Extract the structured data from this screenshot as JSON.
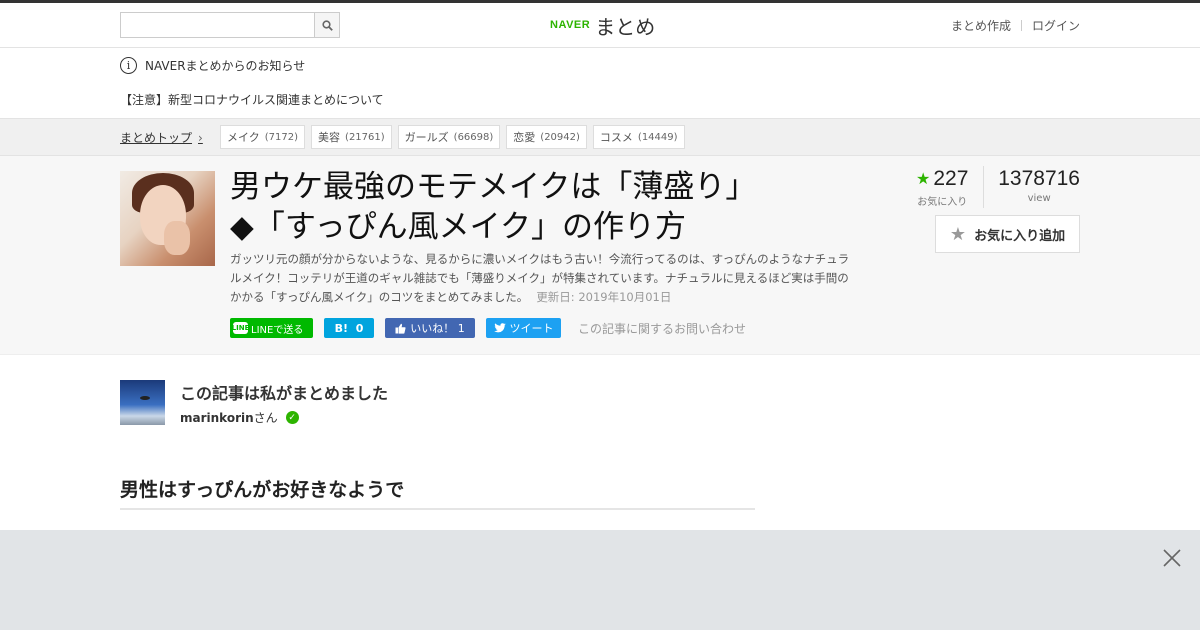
{
  "header": {
    "search_placeholder": "",
    "logo_brand": "NAVER",
    "logo_text": "まとめ",
    "create_label": "まとめ作成",
    "login_label": "ログイン"
  },
  "notice": {
    "title": "NAVERまとめからのお知らせ",
    "link": "【注意】新型コロナウイルス関連まとめについて"
  },
  "categories": {
    "top_label": "まとめトップ",
    "items": [
      {
        "name": "メイク",
        "count": "(7172)"
      },
      {
        "name": "美容",
        "count": "(21761)"
      },
      {
        "name": "ガールズ",
        "count": "(66698)"
      },
      {
        "name": "恋愛",
        "count": "(20942)"
      },
      {
        "name": "コスメ",
        "count": "(14449)"
      }
    ]
  },
  "article": {
    "title_line1": "男ウケ最強のモテメイクは「薄盛り」",
    "title_line2": "◆「すっぴん風メイク」の作り方",
    "description": "ガッツリ元の顔が分からないような、見るからに濃いメイクはもう古い！今流行ってるのは、すっぴんのようなナチュラルメイク！コッテリが王道のギャル雑誌でも「薄盛りメイク」が特集されています。ナチュラルに見えるほど実は手間のかかる「すっぴん風メイク」のコツをまとめてみました。",
    "updated": "更新日: 2019年10月01日",
    "favorites": "227",
    "favorites_label": "お気に入り",
    "views": "1378716",
    "views_label": "view",
    "fav_button": "お気に入り追加"
  },
  "share": {
    "line_icon": "LINE",
    "line_label": "LINEで送る",
    "hatena_label": "B!",
    "hatena_count": "0",
    "fb_label": "いいね！",
    "fb_count": "1",
    "tw_label": "ツイート",
    "contact": "この記事に関するお問い合わせ"
  },
  "author": {
    "heading": "この記事は私がまとめました",
    "name": "marinkorin",
    "suffix": "さん"
  },
  "section": {
    "heading": "男性はすっぴんがお好きなようで"
  },
  "colors": {
    "accent_green": "#2db400",
    "line_green": "#00b900",
    "hatena_blue": "#00a4de",
    "facebook_blue": "#4267b2",
    "twitter_blue": "#1da1f2"
  }
}
